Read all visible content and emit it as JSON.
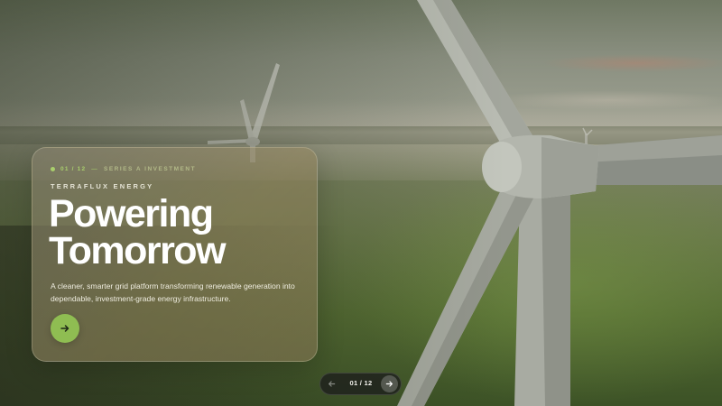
{
  "hero": {
    "slide_index": "01 / 12",
    "separator": "—",
    "series_label": "SERIES A INVESTMENT",
    "brand": "TERRAFLUX ENERGY",
    "title_line_1": "Powering",
    "title_line_2": "Tomorrow",
    "description": "A cleaner, smarter grid platform transforming renewable generation into dependable, investment-grade energy infrastructure.",
    "cta_icon": "arrow-right-icon"
  },
  "pager": {
    "prev_icon": "arrow-left-icon",
    "next_icon": "arrow-right-icon",
    "count": "01 / 12"
  },
  "colors": {
    "accent": "#8fbd52",
    "kicker": "#a9cf6c"
  }
}
